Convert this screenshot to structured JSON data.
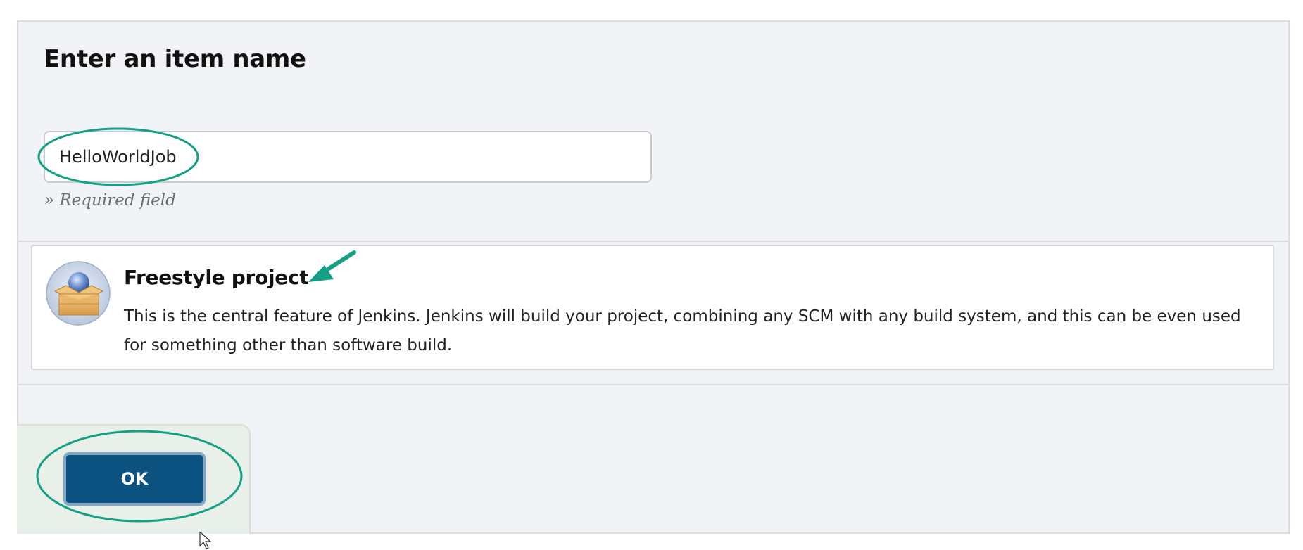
{
  "form": {
    "heading": "Enter an item name",
    "item_name_value": "HelloWorldJob",
    "required_note": "» Required field"
  },
  "project_type": {
    "icon": "package-box-icon",
    "title": "Freestyle project",
    "description": "This is the central feature of Jenkins. Jenkins will build your project, combining any SCM with any build system, and this can be even used for something other than software build."
  },
  "actions": {
    "ok_label": "OK"
  },
  "colors": {
    "panel_background": "#f2f3f6",
    "ok_button": "#0b5280",
    "annotation_highlight": "#14a085"
  }
}
